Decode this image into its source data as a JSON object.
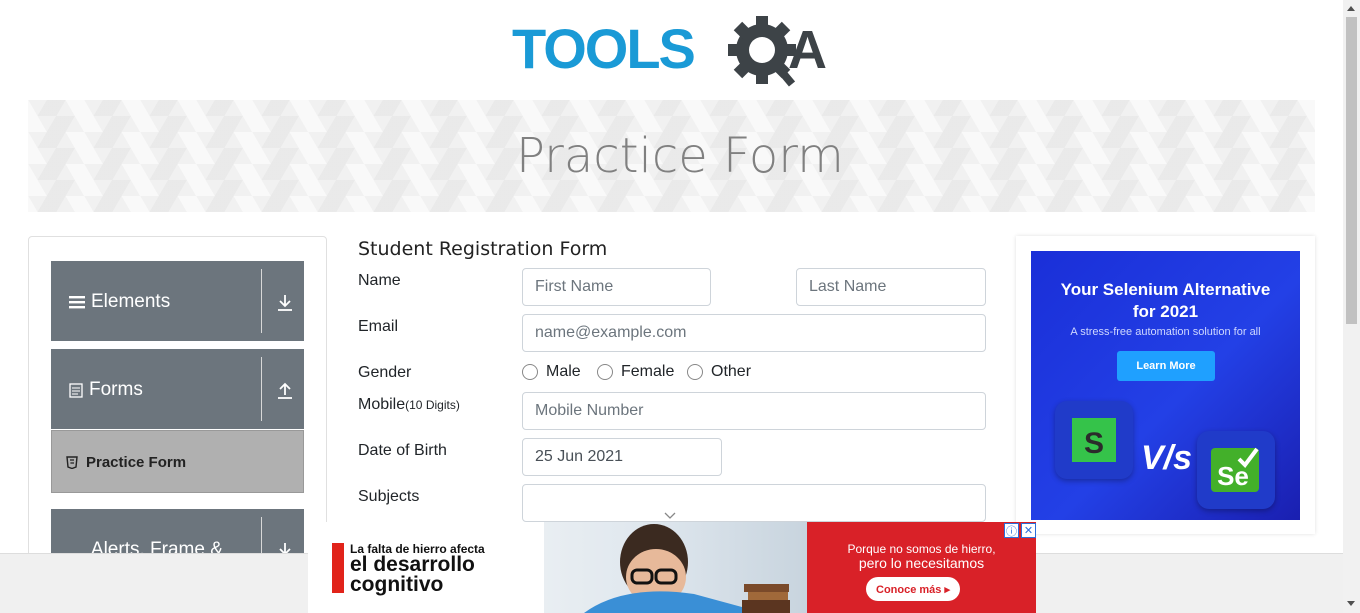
{
  "header": {
    "logo_text_left": "TOOLS",
    "logo_text_right": "QA",
    "logo_icon": "gear-magnifier-icon"
  },
  "banner": {
    "title": "Practice Form"
  },
  "sidebar": {
    "groups": [
      {
        "label": "Elements",
        "icon": "hamburger-icon",
        "arrow": "download-arrow-icon"
      },
      {
        "label": "Forms",
        "icon": "document-icon",
        "arrow": "upload-arrow-icon"
      },
      {
        "label": "Alerts, Frame & Windows",
        "icon": "window-icon",
        "arrow": "download-arrow-icon"
      }
    ],
    "active_item": {
      "label": "Practice Form",
      "icon": "html5-icon"
    }
  },
  "form": {
    "title": "Student Registration Form",
    "name_label": "Name",
    "first_name_placeholder": "First Name",
    "last_name_placeholder": "Last Name",
    "email_label": "Email",
    "email_placeholder": "name@example.com",
    "gender_label": "Gender",
    "gender_options": [
      "Male",
      "Female",
      "Other"
    ],
    "mobile_label": "Mobile",
    "mobile_hint": "(10 Digits)",
    "mobile_placeholder": "Mobile Number",
    "dob_label": "Date of Birth",
    "dob_value": "25 Jun 2021",
    "subjects_label": "Subjects",
    "subjects_value": ""
  },
  "ad_right": {
    "headline": "Your Selenium Alternative for 2021",
    "subline": "A stress-free automation solution for all",
    "button": "Learn More",
    "vs_text": "V/s",
    "left_tile_letter": "S",
    "right_tile_text": "Se",
    "colors": {
      "background": "#1f35d9",
      "button": "#1fa0ff"
    }
  },
  "ad_bottom": {
    "line1": "La falta de hierro afecta",
    "line2": "el desarrollo",
    "line3": "cognitivo",
    "right_line1": "Porque no somos de hierro,",
    "right_line2": "pero lo necesitamos",
    "button": "Conoce más ▸",
    "info_icon": "ⓘ",
    "close_icon": "✕",
    "colors": {
      "accent": "#d92128"
    }
  }
}
